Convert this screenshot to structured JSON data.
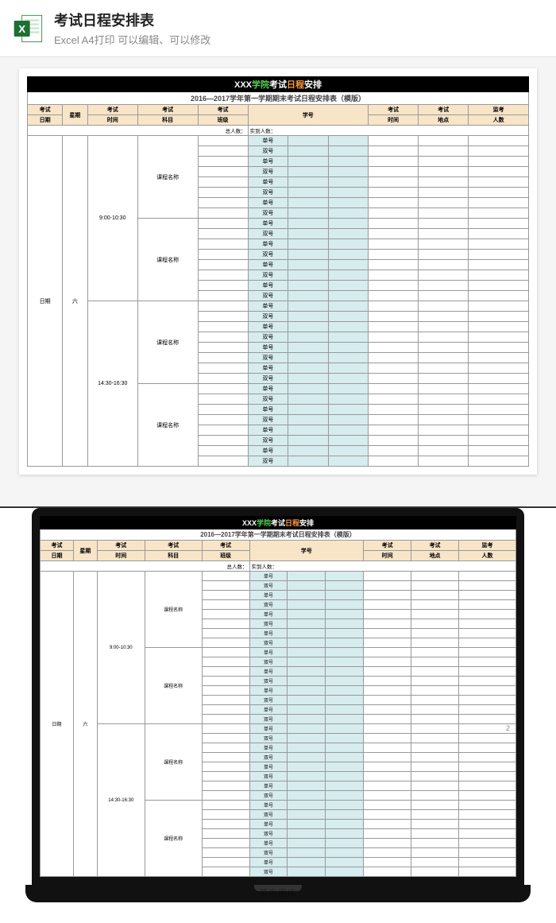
{
  "header": {
    "title": "考试日程安排表",
    "subtitle": "Excel A4打印 可以编辑、可以修改"
  },
  "sheet": {
    "bannerParts": {
      "p1": "XXX",
      "p2": "学院",
      "p3": "考试",
      "p4": "日程",
      "p5": "安排"
    },
    "subtitle": "2016—2017学年第一学期期末考试日程安排表（模版）",
    "headers": {
      "c1": "考试",
      "c1b": "日期",
      "c2": "星期",
      "c3": "考试",
      "c3b": "时间",
      "c4": "考试",
      "c4b": "科目",
      "c5": "考试",
      "c5b": "班级",
      "c6": "学号",
      "c7": "考试",
      "c7b": "时间",
      "c8": "考试",
      "c8b": "地点",
      "c9": "监考",
      "c9b": "人数"
    },
    "countRow": {
      "left": "总人数：",
      "right": "实到人数："
    },
    "dateLabel": "日期",
    "weekdayLabel": "六",
    "timeSlots": [
      "9:00-10:30",
      "14:30-16:30"
    ],
    "courseLabel": "课程名称",
    "rowTypes": [
      "单号",
      "双号"
    ],
    "pageNumber": "2"
  },
  "watermark": "菜鸟图库"
}
